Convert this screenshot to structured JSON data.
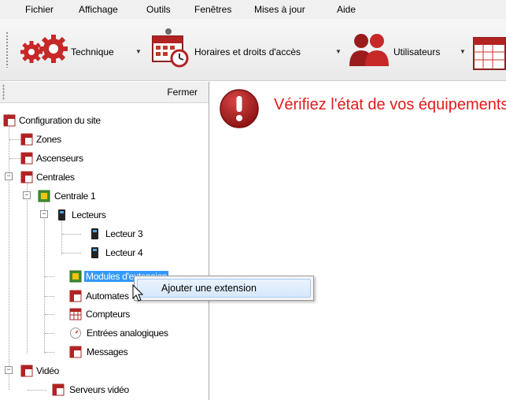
{
  "menu": [
    "Fichier",
    "Affichage",
    "Outils",
    "Fenêtres",
    "Mises à jour",
    "Aide"
  ],
  "toolbar": {
    "technique": "Technique",
    "horaires": "Horaires et droits d'accès",
    "utilisateurs": "Utilisateurs"
  },
  "panel": {
    "close_label": "Fermer"
  },
  "tree": {
    "config": "Configuration du site",
    "zones": "Zones",
    "ascenseurs": "Ascenseurs",
    "centrales": "Centrales",
    "centrale1": "Centrale 1",
    "lecteurs": "Lecteurs",
    "lecteur3": "Lecteur 3",
    "lecteur4": "Lecteur 4",
    "modules": "Modules d'extension",
    "automates": "Automates",
    "compteurs": "Compteurs",
    "entrees": "Entrées analogiques",
    "messages": "Messages",
    "video": "Vidéo",
    "serveurs": "Serveurs vidéo"
  },
  "content": {
    "alert": "Vérifiez l'état de vos équipements"
  },
  "context_menu": {
    "add_extension": "Ajouter une extension"
  },
  "colors": {
    "alert": "#e21b1b",
    "selection": "#3399ff",
    "icon_red": "#b22222"
  }
}
